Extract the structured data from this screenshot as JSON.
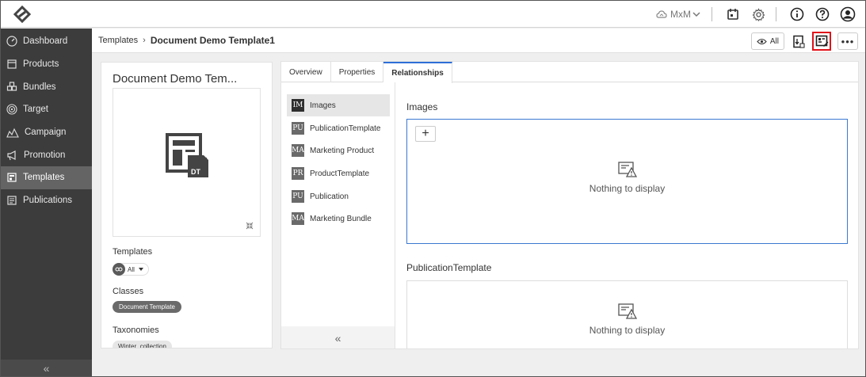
{
  "topbar": {
    "tenant": "MxM",
    "icons": [
      "logo-icon",
      "tenant-icon",
      "chevron-down-icon",
      "calendar-icon",
      "gear-icon",
      "info-icon",
      "help-icon",
      "user-icon"
    ]
  },
  "sidebar": {
    "items": [
      {
        "label": "Dashboard",
        "icon": "dashboard-icon"
      },
      {
        "label": "Products",
        "icon": "products-icon"
      },
      {
        "label": "Bundles",
        "icon": "bundles-icon"
      },
      {
        "label": "Target",
        "icon": "target-icon"
      },
      {
        "label": "Campaign",
        "icon": "campaign-icon"
      },
      {
        "label": "Promotion",
        "icon": "promotion-icon"
      },
      {
        "label": "Templates",
        "icon": "templates-icon",
        "active": true
      },
      {
        "label": "Publications",
        "icon": "publications-icon"
      }
    ],
    "collapse_label": "«"
  },
  "breadcrumb": {
    "parent": "Templates",
    "separator": "›",
    "current": "Document Demo Template1"
  },
  "actions": {
    "view_all_label": "All",
    "more_label": "•••"
  },
  "card": {
    "title": "Document Demo Tem...",
    "preview_badge": "DT",
    "templates_label": "Templates",
    "templates_chip": "All",
    "classes_label": "Classes",
    "classes_chip": "Document Template",
    "taxonomies_label": "Taxonomies",
    "taxonomies_chip": "Winter_collection"
  },
  "tabs": [
    {
      "label": "Overview"
    },
    {
      "label": "Properties"
    },
    {
      "label": "Relationships",
      "active": true
    }
  ],
  "relationships": [
    {
      "badge": "IM",
      "label": "Images",
      "active": true
    },
    {
      "badge": "PU",
      "label": "PublicationTemplate"
    },
    {
      "badge": "MA",
      "label": "Marketing Product"
    },
    {
      "badge": "PR",
      "label": "ProductTemplate"
    },
    {
      "badge": "PU",
      "label": "Publication"
    },
    {
      "badge": "MA",
      "label": "Marketing Bundle"
    }
  ],
  "rel_collapse_label": "«",
  "sections": [
    {
      "title": "Images",
      "empty_text": "Nothing to display",
      "add_label": "+"
    },
    {
      "title": "PublicationTemplate",
      "empty_text": "Nothing to display"
    }
  ],
  "colors": {
    "sidebar_bg": "#3c3c3c",
    "sidebar_active": "#646464",
    "accent_blue": "#3b78d0",
    "highlight_red": "#e0131a"
  }
}
